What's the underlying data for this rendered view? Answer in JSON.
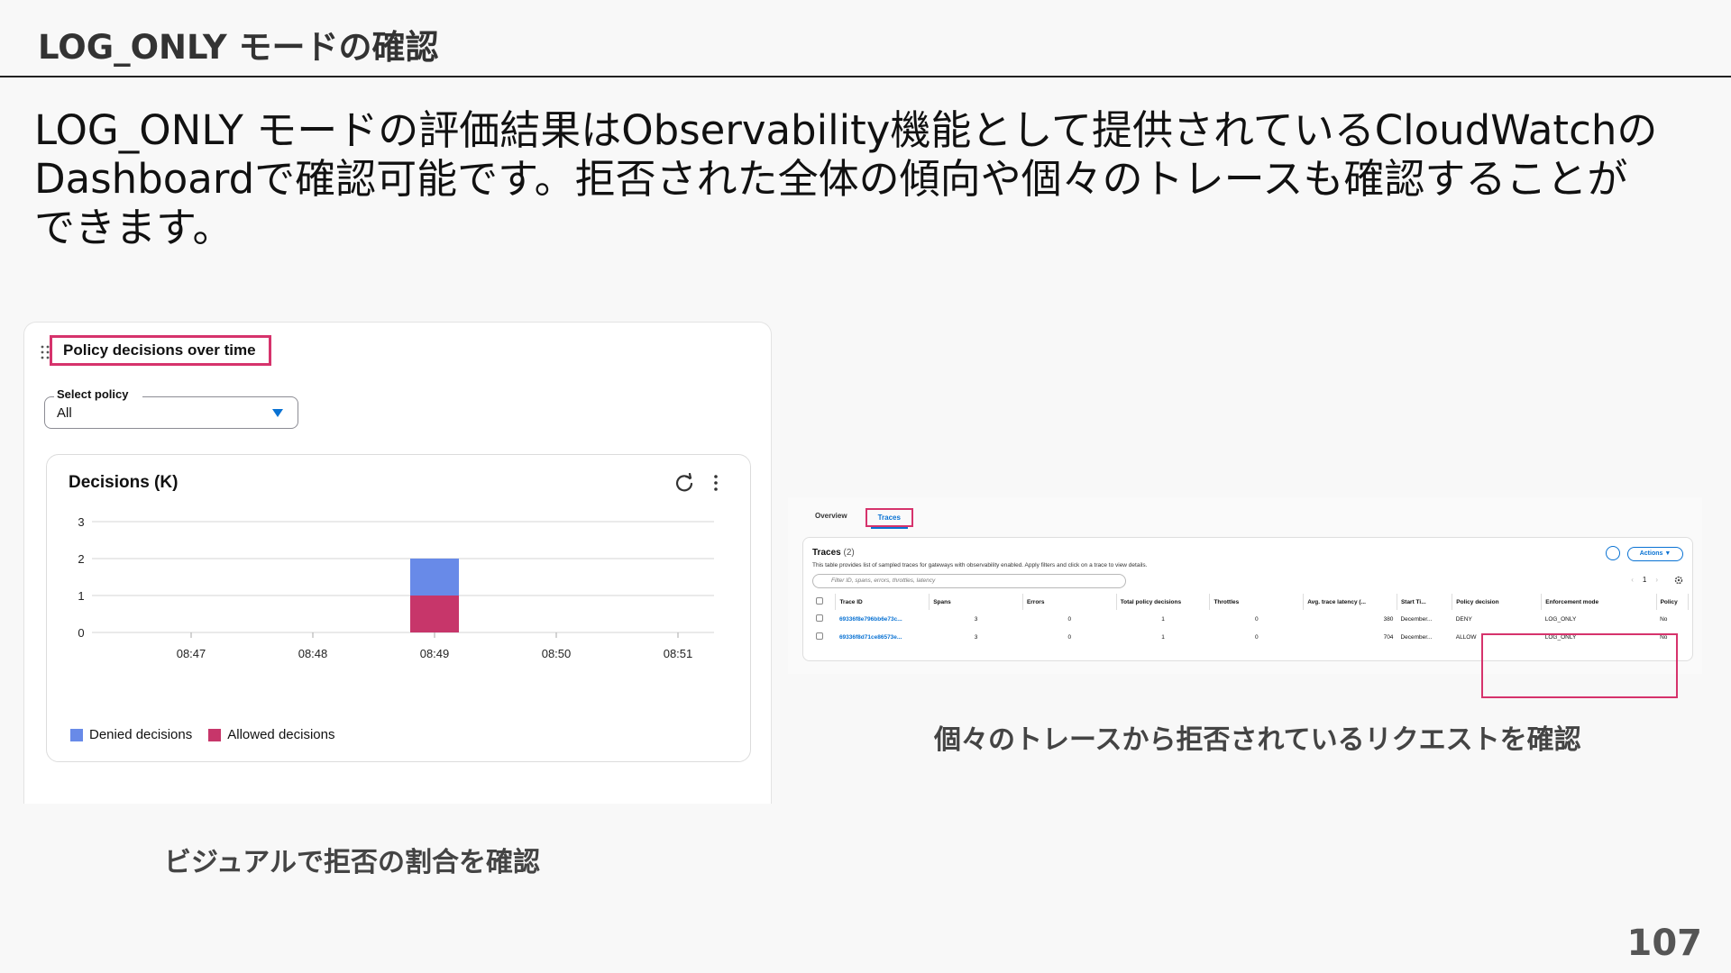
{
  "slide": {
    "title": "LOG_ONLY モードの確認",
    "body_lines": [
      "LOG_ONLY モードの評価結果はObservability機能として提供されているCloudWatchの",
      "Dashboardで確認可能です。拒否された全体の傾向や個々のトレースも確認することが",
      "できます。"
    ],
    "caption_left": "ビジュアルで拒否の割合を確認",
    "caption_right": "個々のトレースから拒否されているリクエストを確認",
    "page_number": "107"
  },
  "policy_panel": {
    "title": "Policy decisions over time",
    "select_label": "Select policy",
    "select_value": "All",
    "chart_title": "Decisions (K)"
  },
  "chart_data": {
    "type": "bar",
    "title": "Decisions (K)",
    "categories": [
      "08:47",
      "08:48",
      "08:49",
      "08:50",
      "08:51"
    ],
    "series": [
      {
        "name": "Allowed decisions",
        "color": "#c7366a",
        "values": [
          0,
          0,
          1,
          0,
          0
        ]
      },
      {
        "name": "Denied decisions",
        "color": "#688ae8",
        "values": [
          0,
          0,
          1,
          0,
          0
        ]
      }
    ],
    "stacked": true,
    "yticks": [
      0,
      1,
      2,
      3
    ],
    "ylim": [
      0,
      3
    ],
    "grid": true,
    "legend": [
      "Denied decisions",
      "Allowed decisions"
    ],
    "legend_position": "bottom-left"
  },
  "traces_panel": {
    "tabs": [
      "Overview",
      "Traces"
    ],
    "active_tab": "Traces",
    "title": "Traces",
    "count": "(2)",
    "description": "This table provides list of sampled traces for gateways with observability enabled. Apply filters and click on a trace to view details.",
    "search_placeholder": "Filter ID, spans, errors, throttles, latency",
    "actions_label": "Actions ▼",
    "page": "1",
    "columns": [
      "Trace ID",
      "Spans",
      "Errors",
      "Total policy decisions",
      "Throttles",
      "Avg. trace latency (...",
      "Start Ti...",
      "Policy decision",
      "Enforcement mode",
      "Policy"
    ],
    "rows": [
      {
        "trace_id": "69336f8e796bb6e73c...",
        "spans": "3",
        "errors": "0",
        "total_policy_decisions": "1",
        "throttles": "0",
        "latency": "380",
        "start": "December...",
        "policy_decision": "DENY",
        "enforcement_mode": "LOG_ONLY",
        "policy": "No"
      },
      {
        "trace_id": "69336f8d71ce86573e...",
        "spans": "3",
        "errors": "0",
        "total_policy_decisions": "1",
        "throttles": "0",
        "latency": "704",
        "start": "December...",
        "policy_decision": "ALLOW",
        "enforcement_mode": "LOG_ONLY",
        "policy": "No"
      }
    ]
  },
  "colors": {
    "accent_blue": "#0972d3",
    "highlight_pink": "#d6336c",
    "denied": "#688ae8",
    "allowed": "#c7366a"
  }
}
